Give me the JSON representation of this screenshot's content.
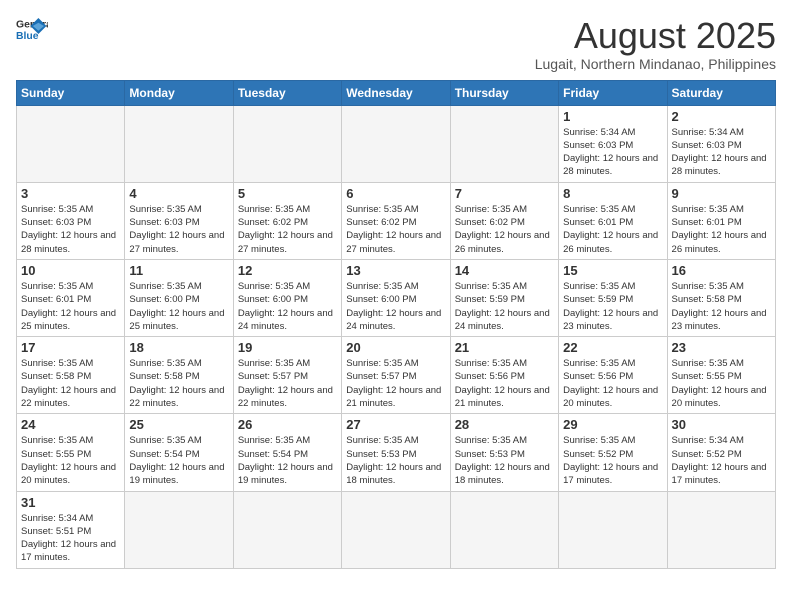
{
  "header": {
    "logo_general": "General",
    "logo_blue": "Blue",
    "title": "August 2025",
    "subtitle": "Lugait, Northern Mindanao, Philippines"
  },
  "days_of_week": [
    "Sunday",
    "Monday",
    "Tuesday",
    "Wednesday",
    "Thursday",
    "Friday",
    "Saturday"
  ],
  "weeks": [
    [
      {
        "day": "",
        "info": ""
      },
      {
        "day": "",
        "info": ""
      },
      {
        "day": "",
        "info": ""
      },
      {
        "day": "",
        "info": ""
      },
      {
        "day": "",
        "info": ""
      },
      {
        "day": "1",
        "info": "Sunrise: 5:34 AM\nSunset: 6:03 PM\nDaylight: 12 hours\nand 28 minutes."
      },
      {
        "day": "2",
        "info": "Sunrise: 5:34 AM\nSunset: 6:03 PM\nDaylight: 12 hours\nand 28 minutes."
      }
    ],
    [
      {
        "day": "3",
        "info": "Sunrise: 5:35 AM\nSunset: 6:03 PM\nDaylight: 12 hours\nand 28 minutes."
      },
      {
        "day": "4",
        "info": "Sunrise: 5:35 AM\nSunset: 6:03 PM\nDaylight: 12 hours\nand 27 minutes."
      },
      {
        "day": "5",
        "info": "Sunrise: 5:35 AM\nSunset: 6:02 PM\nDaylight: 12 hours\nand 27 minutes."
      },
      {
        "day": "6",
        "info": "Sunrise: 5:35 AM\nSunset: 6:02 PM\nDaylight: 12 hours\nand 27 minutes."
      },
      {
        "day": "7",
        "info": "Sunrise: 5:35 AM\nSunset: 6:02 PM\nDaylight: 12 hours\nand 26 minutes."
      },
      {
        "day": "8",
        "info": "Sunrise: 5:35 AM\nSunset: 6:01 PM\nDaylight: 12 hours\nand 26 minutes."
      },
      {
        "day": "9",
        "info": "Sunrise: 5:35 AM\nSunset: 6:01 PM\nDaylight: 12 hours\nand 26 minutes."
      }
    ],
    [
      {
        "day": "10",
        "info": "Sunrise: 5:35 AM\nSunset: 6:01 PM\nDaylight: 12 hours\nand 25 minutes."
      },
      {
        "day": "11",
        "info": "Sunrise: 5:35 AM\nSunset: 6:00 PM\nDaylight: 12 hours\nand 25 minutes."
      },
      {
        "day": "12",
        "info": "Sunrise: 5:35 AM\nSunset: 6:00 PM\nDaylight: 12 hours\nand 24 minutes."
      },
      {
        "day": "13",
        "info": "Sunrise: 5:35 AM\nSunset: 6:00 PM\nDaylight: 12 hours\nand 24 minutes."
      },
      {
        "day": "14",
        "info": "Sunrise: 5:35 AM\nSunset: 5:59 PM\nDaylight: 12 hours\nand 24 minutes."
      },
      {
        "day": "15",
        "info": "Sunrise: 5:35 AM\nSunset: 5:59 PM\nDaylight: 12 hours\nand 23 minutes."
      },
      {
        "day": "16",
        "info": "Sunrise: 5:35 AM\nSunset: 5:58 PM\nDaylight: 12 hours\nand 23 minutes."
      }
    ],
    [
      {
        "day": "17",
        "info": "Sunrise: 5:35 AM\nSunset: 5:58 PM\nDaylight: 12 hours\nand 22 minutes."
      },
      {
        "day": "18",
        "info": "Sunrise: 5:35 AM\nSunset: 5:58 PM\nDaylight: 12 hours\nand 22 minutes."
      },
      {
        "day": "19",
        "info": "Sunrise: 5:35 AM\nSunset: 5:57 PM\nDaylight: 12 hours\nand 22 minutes."
      },
      {
        "day": "20",
        "info": "Sunrise: 5:35 AM\nSunset: 5:57 PM\nDaylight: 12 hours\nand 21 minutes."
      },
      {
        "day": "21",
        "info": "Sunrise: 5:35 AM\nSunset: 5:56 PM\nDaylight: 12 hours\nand 21 minutes."
      },
      {
        "day": "22",
        "info": "Sunrise: 5:35 AM\nSunset: 5:56 PM\nDaylight: 12 hours\nand 20 minutes."
      },
      {
        "day": "23",
        "info": "Sunrise: 5:35 AM\nSunset: 5:55 PM\nDaylight: 12 hours\nand 20 minutes."
      }
    ],
    [
      {
        "day": "24",
        "info": "Sunrise: 5:35 AM\nSunset: 5:55 PM\nDaylight: 12 hours\nand 20 minutes."
      },
      {
        "day": "25",
        "info": "Sunrise: 5:35 AM\nSunset: 5:54 PM\nDaylight: 12 hours\nand 19 minutes."
      },
      {
        "day": "26",
        "info": "Sunrise: 5:35 AM\nSunset: 5:54 PM\nDaylight: 12 hours\nand 19 minutes."
      },
      {
        "day": "27",
        "info": "Sunrise: 5:35 AM\nSunset: 5:53 PM\nDaylight: 12 hours\nand 18 minutes."
      },
      {
        "day": "28",
        "info": "Sunrise: 5:35 AM\nSunset: 5:53 PM\nDaylight: 12 hours\nand 18 minutes."
      },
      {
        "day": "29",
        "info": "Sunrise: 5:35 AM\nSunset: 5:52 PM\nDaylight: 12 hours\nand 17 minutes."
      },
      {
        "day": "30",
        "info": "Sunrise: 5:34 AM\nSunset: 5:52 PM\nDaylight: 12 hours\nand 17 minutes."
      }
    ],
    [
      {
        "day": "31",
        "info": "Sunrise: 5:34 AM\nSunset: 5:51 PM\nDaylight: 12 hours\nand 17 minutes."
      },
      {
        "day": "",
        "info": ""
      },
      {
        "day": "",
        "info": ""
      },
      {
        "day": "",
        "info": ""
      },
      {
        "day": "",
        "info": ""
      },
      {
        "day": "",
        "info": ""
      },
      {
        "day": "",
        "info": ""
      }
    ]
  ]
}
